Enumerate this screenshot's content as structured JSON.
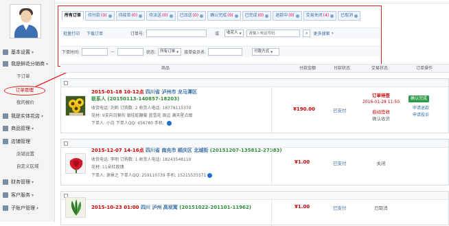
{
  "sidebar": {
    "groups": [
      {
        "label": "基本设置"
      },
      {
        "label": "我是鲜花分销商"
      },
      {
        "label": "我是实体花店"
      },
      {
        "label": "商品管理"
      },
      {
        "label": "店铺管理"
      },
      {
        "label": "财务管理"
      },
      {
        "label": "客户服务"
      },
      {
        "label": "子账户管理"
      }
    ],
    "subs": [
      "下订单",
      "订单管理",
      "我的报价",
      "店铺设置",
      "自定义区域"
    ]
  },
  "tabs": [
    {
      "label": "所有订单",
      "count": ""
    },
    {
      "label": "待付款",
      "count": "(0)"
    },
    {
      "label": "待接单",
      "count": "(0)"
    },
    {
      "label": "待派送",
      "count": "(0)"
    },
    {
      "label": "已派送",
      "count": "(0)"
    },
    {
      "label": "确认完成",
      "count": "(0)"
    },
    {
      "label": "已完成",
      "count": "(0)"
    },
    {
      "label": "退款中",
      "count": "(0)"
    },
    {
      "label": "交易关闭",
      "count": "(4)"
    },
    {
      "label": "已取消",
      "count": ""
    }
  ],
  "filters": {
    "batch_link": "批量打印",
    "download_link": "下载订单",
    "order_no_label": "订单号:",
    "or_label": "或",
    "receiver_select": "收花人",
    "phone_placeholder": "请输入电话号码",
    "advanced_link": "更多搜索",
    "date_label": "下单时间:",
    "date_sep": "—",
    "status_label": "状态:",
    "status_select": "所有订单",
    "member_label": "接单会员名:",
    "pay_select": "付款方式"
  },
  "table_head": [
    "商品",
    "付款金额",
    "付款状态",
    "交易状态",
    "订单操作"
  ],
  "orders": [
    {
      "title_date": "2015-01-18  10-12点",
      "title_addr": "四川省 泸州市 龙马潭区",
      "title_id": "联系人 (20150113-140857-18203)",
      "line1": "收货电话: 刘莉    订购数: 2    收货人电话: 18778115370",
      "line2": "花材: 9支向日葵的 银桂蛇鞭菊 蓝雪花 周边 满天星点缀",
      "line3": "下单人: 小白    下单人QQ: 456780 手机: ",
      "price": "¥190.00",
      "pay": "已支付",
      "status_red": "订单待签",
      "status_time": "2016-01-28 11:50",
      "status_green": "自动签收",
      "status_extra": "确认收货",
      "btn": "确认完成",
      "link1": "申请退款",
      "link2": "申请投诉"
    },
    {
      "title_date": "2015-12-07  14-16点",
      "title_addr": "四川省 南充市 顺庆区 北城街",
      "title_id": "(20151207-135812-27383)",
      "line1": "收货电话: 李明    订购数: 1    收货人电话: 18243548110",
      "line2": "花材: 11朵红玫瑰",
      "line3": "下单人: 谢景之    下单人QQ: 259110739 手机: 15215535571",
      "price": "¥1.00",
      "pay": "已支付",
      "status_plain": "关闭"
    },
    {
      "title_date": "2015-10-23 01:00",
      "title_addr": "四川 泸州 高坝寓",
      "title_id": "(20151022-201101-11962)",
      "price": "¥1.00",
      "pay": "已支付",
      "status_plain": "已取消"
    }
  ],
  "colors": {
    "accent_red": "#e02020",
    "link_blue": "#3a6ea5",
    "ok_green": "#2e9b4a"
  }
}
